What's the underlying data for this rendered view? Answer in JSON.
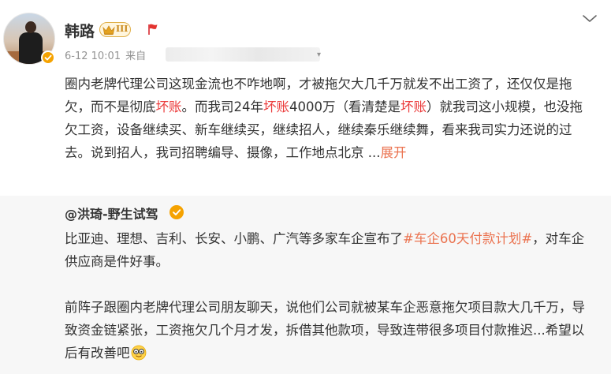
{
  "post": {
    "username": "韩路",
    "level_badge": "III",
    "date": "6-12 10:01",
    "source_prefix": "来自",
    "content": {
      "p1": "圈内老牌代理公司这现金流也不咋地啊，才被拖欠大几千万就发不出工资了，还仅仅是拖欠，而不是彻底",
      "hl1": "坏账",
      "p2": "。而我司24年",
      "hl2": "坏账",
      "p3": "4000万（看清楚是",
      "hl3": "坏账",
      "p4": "）就我司这小规模，也没拖欠工资，设备继续买、新车继续买，继续招人，继续秦乐继续舞，看来我司实力还说的过去。说到招人，我司招聘编导、摄像，工作地点北京 ...",
      "expand": "展开"
    }
  },
  "repost": {
    "author": "@洪琦-野生试驾",
    "text_a": "比亚迪、理想、吉利、长安、小鹏、广汽等多家车企宣布了",
    "topic": "#车企60天付款计划#",
    "text_b": "，对车企供应商是件好事。",
    "text_c": "前阵子跟圈内老牌代理公司朋友聊天，说他们公司就被某车企恶意拖欠项目款大几千万，导致资金链紧张，工资拖欠几个月才发，拆借其他款项，导致连带很多项目付款推迟...希望以后有改善吧"
  },
  "icons": {
    "verify": "verified-badge-icon",
    "crown": "crown-icon",
    "flag": "flag-icon",
    "collapse": "chevron-down-icon",
    "emoji": "nerd-face-emoji-icon"
  },
  "colors": {
    "highlight": "#eb3c3c",
    "link": "#eb7350",
    "verify": "#f5a200",
    "repost_bg": "#f7f7f7"
  }
}
